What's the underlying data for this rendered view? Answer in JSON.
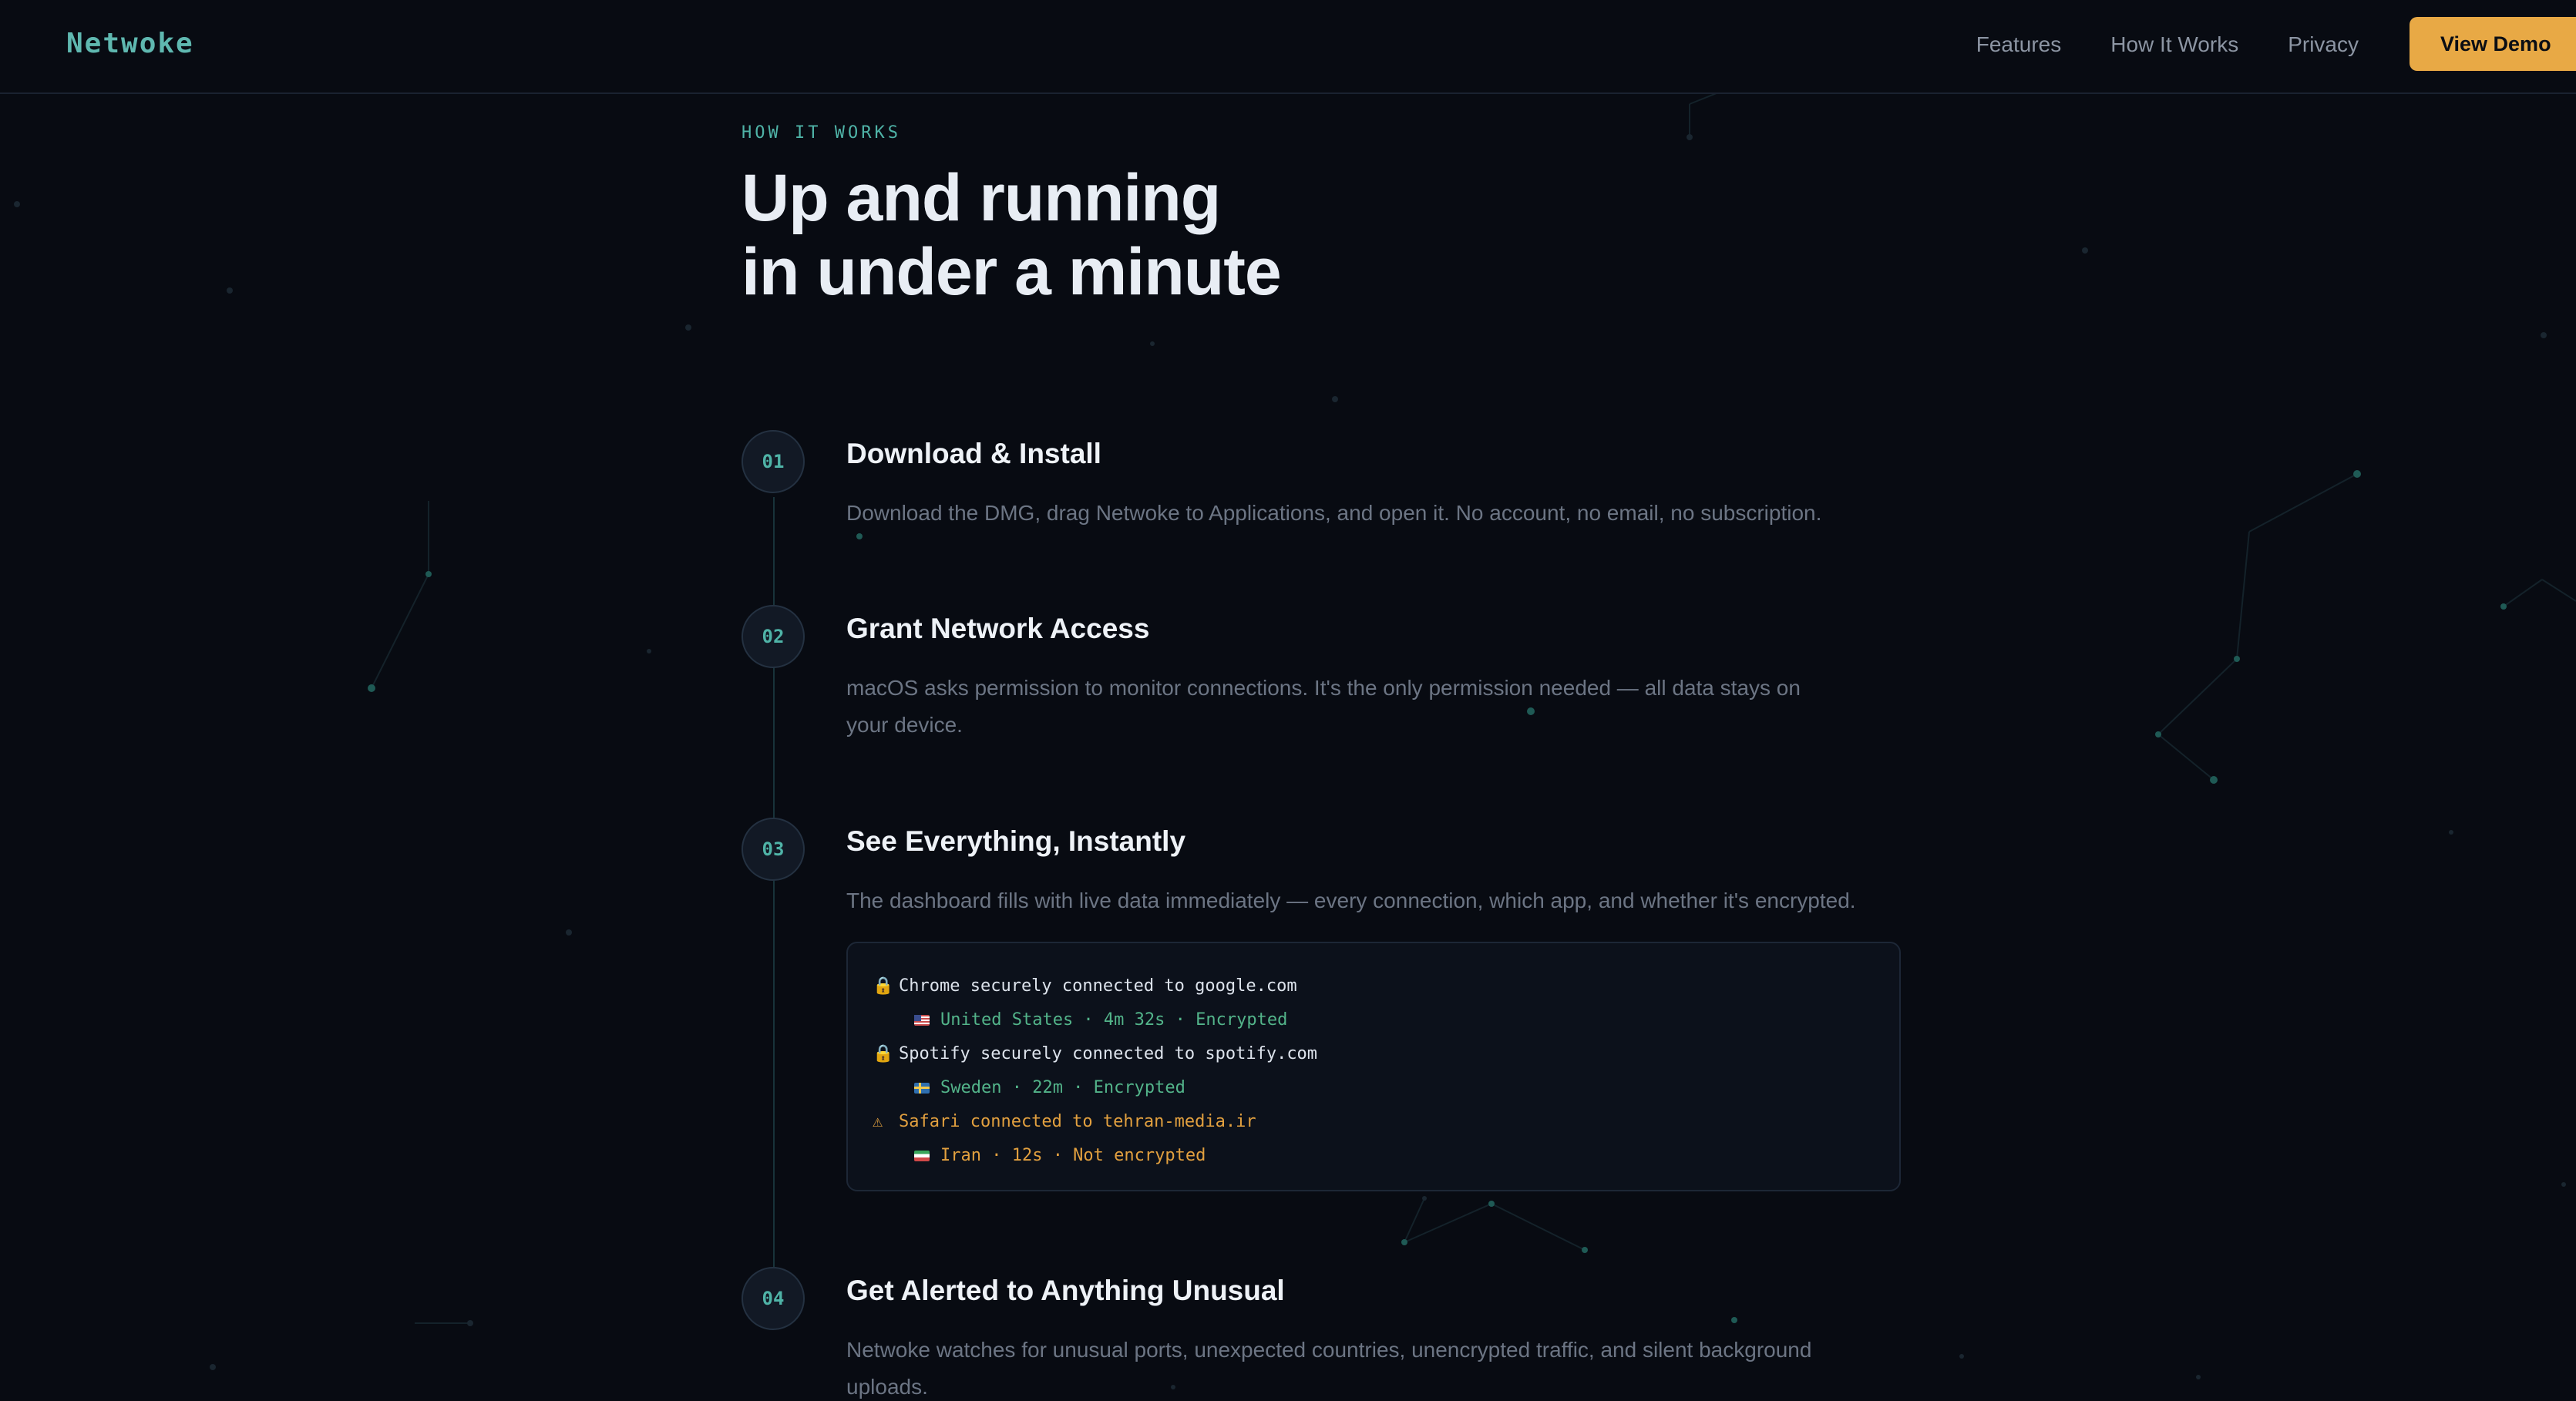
{
  "nav": {
    "logo": "Netwoke",
    "links": [
      "Features",
      "How It Works",
      "Privacy"
    ],
    "cta": "View Demo"
  },
  "hero": {
    "eyebrow": "HOW IT WORKS",
    "title_line1": "Up and running",
    "title_line2": "in under a minute"
  },
  "steps": [
    {
      "number": "01",
      "title": "Download & Install",
      "description": "Download the DMG, drag Netwoke to Applications, and open it. No account, no email, no subscription."
    },
    {
      "number": "02",
      "title": "Grant Network Access",
      "description": "macOS asks permission to monitor connections. It's the only permission needed — all data stays on your device."
    },
    {
      "number": "03",
      "title": "See Everything, Instantly",
      "description": "The dashboard fills with live data immediately — every connection, which app, and whether it's encrypted."
    },
    {
      "number": "04",
      "title": "Get Alerted to Anything Unusual",
      "description": "Netwoke watches for unusual ports, unexpected countries, unencrypted traffic, and silent background uploads."
    }
  ],
  "terminal": {
    "lines": [
      {
        "icon": "lock-icon",
        "text": "Chrome securely connected to google.com",
        "color": "#dde3ec"
      },
      {
        "flag": "us-flag-icon",
        "text": "United States · 4m 32s · Encrypted",
        "color": "#53b48a"
      },
      {
        "icon": "lock-icon",
        "text": "Spotify securely connected to spotify.com",
        "color": "#dde3ec"
      },
      {
        "flag": "se-flag-icon",
        "text": "Sweden · 22m · Encrypted",
        "color": "#53b48a"
      },
      {
        "icon": "warning-icon",
        "text": "Safari connected to tehran-media.ir",
        "color": "#e2a03f"
      },
      {
        "flag": "ir-flag-icon",
        "text": "Iran · 12s · Not encrypted",
        "color": "#e2a03f"
      }
    ]
  },
  "colors": {
    "accent": "#4fb3a7",
    "cta": "#e8a945",
    "background": "#080b12",
    "encrypted": "#53b48a",
    "warning": "#e2a03f"
  }
}
